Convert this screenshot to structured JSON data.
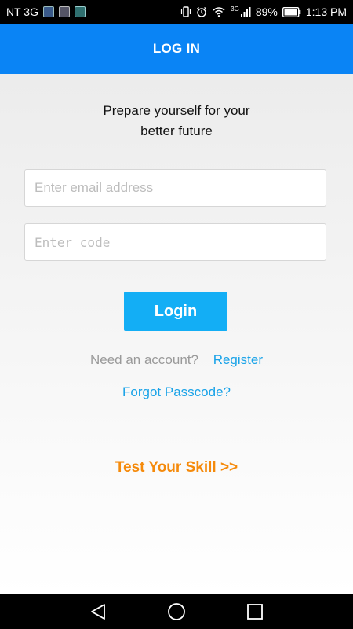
{
  "status_bar": {
    "carrier": "NT 3G",
    "network": "3G",
    "battery": "89%",
    "time": "1:13 PM",
    "icons": [
      "app-notification-icon",
      "app-notification-icon",
      "app-notification-icon",
      "vibrate-icon",
      "alarm-icon",
      "wifi-icon",
      "signal-icon",
      "battery-icon"
    ]
  },
  "app_bar": {
    "title": "LOG IN",
    "color": "#0a84f5"
  },
  "main": {
    "subtitle_line1": "Prepare yourself for your",
    "subtitle_line2": "better future",
    "email": {
      "placeholder": "Enter email address",
      "value": ""
    },
    "code": {
      "placeholder": "Enter code",
      "value": ""
    },
    "login_label": "Login",
    "need_account_text": "Need an account?",
    "register_label": "Register",
    "forgot_label": "Forgot Passcode?",
    "test_skill_label": "Test Your Skill >>",
    "accent_color": "#13aef5",
    "link_color": "#1aa3e8",
    "highlight_color": "#f58a0b"
  },
  "nav_bar": {
    "icons": [
      "back-icon",
      "home-icon",
      "recents-icon"
    ]
  }
}
